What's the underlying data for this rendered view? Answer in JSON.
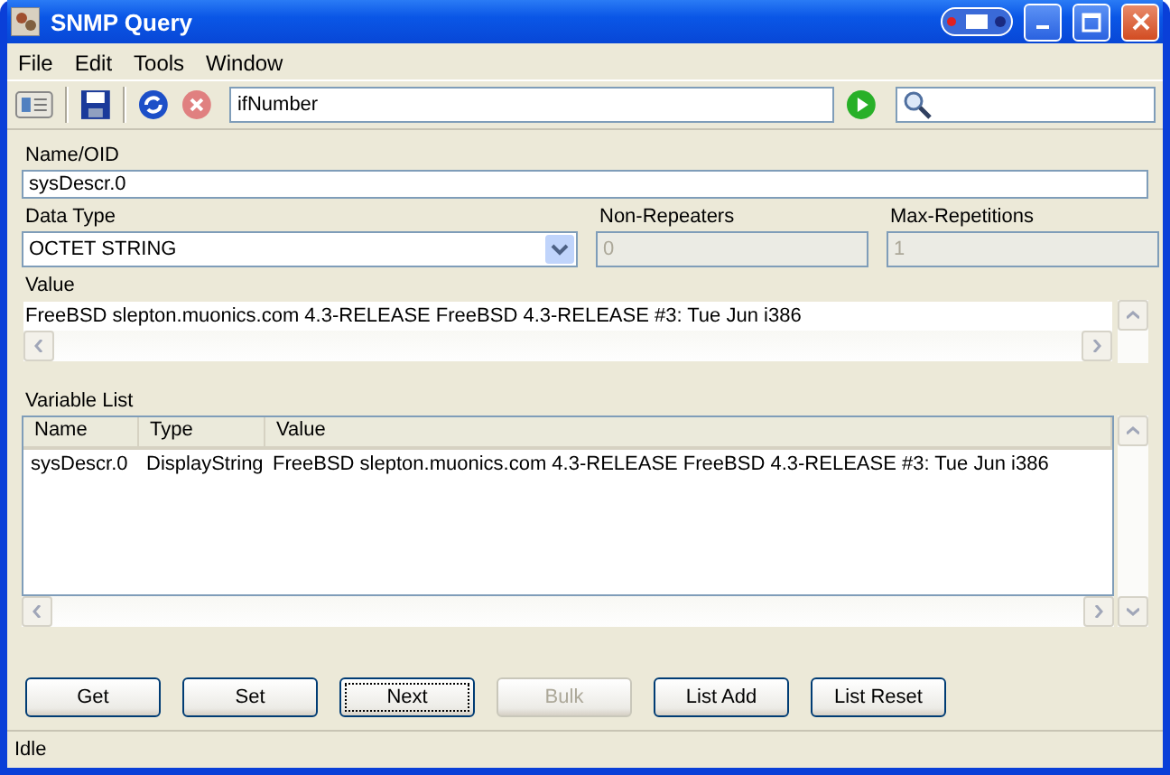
{
  "window": {
    "title": "SNMP Query"
  },
  "menu": [
    "File",
    "Edit",
    "Tools",
    "Window"
  ],
  "toolbar": {
    "oid": "ifNumber"
  },
  "name_oid": {
    "label": "Name/OID",
    "value": "sysDescr.0"
  },
  "data_type": {
    "label": "Data Type",
    "value": "OCTET STRING"
  },
  "non_repeaters": {
    "label": "Non-Repeaters",
    "value": "0",
    "disabled": true
  },
  "max_repetitions": {
    "label": "Max-Repetitions",
    "value": "1",
    "disabled": true
  },
  "value": {
    "label": "Value",
    "text": "FreeBSD slepton.muonics.com 4.3-RELEASE FreeBSD 4.3-RELEASE #3: Tue Jun i386"
  },
  "variable_list": {
    "label": "Variable List",
    "columns": [
      "Name",
      "Type",
      "Value"
    ],
    "rows": [
      [
        "sysDescr.0",
        "DisplayString",
        "FreeBSD slepton.muonics.com 4.3-RELEASE FreeBSD 4.3-RELEASE #3: Tue Jun i386"
      ]
    ]
  },
  "buttons": [
    {
      "label": "Get",
      "disabled": false,
      "focused": false
    },
    {
      "label": "Set",
      "disabled": false,
      "focused": false
    },
    {
      "label": "Next",
      "disabled": false,
      "focused": true
    },
    {
      "label": "Bulk",
      "disabled": true,
      "focused": false
    },
    {
      "label": "List Add",
      "disabled": false,
      "focused": false
    },
    {
      "label": "List Reset",
      "disabled": false,
      "focused": false
    }
  ],
  "status_bar": "Idle"
}
